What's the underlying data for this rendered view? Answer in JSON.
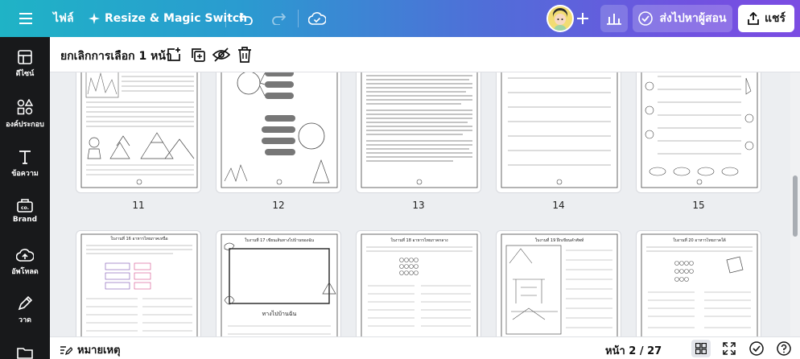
{
  "topbar": {
    "file_label": "ไฟล์",
    "resize_label": "Resize & Magic Switch",
    "send_label": "ส่งไปหาผู้สอน",
    "share_label": "แชร์"
  },
  "sidebar": {
    "items": [
      {
        "label": "ดีไซน์",
        "icon": "layout-icon"
      },
      {
        "label": "องค์ประกอบ",
        "icon": "shapes-icon"
      },
      {
        "label": "ข้อความ",
        "icon": "text-icon"
      },
      {
        "label": "Brand",
        "icon": "brand-icon"
      },
      {
        "label": "อัพโหลด",
        "icon": "upload-icon"
      },
      {
        "label": "วาด",
        "icon": "draw-icon"
      }
    ]
  },
  "selection": {
    "label": "ยกเลิกการเลือก 1 หน้า"
  },
  "pages": {
    "row1": [
      "11",
      "12",
      "13",
      "14",
      "15"
    ],
    "p16_title": "ใบงานที่ 16 อาหารไทยภาคเหนือ",
    "p17_title": "ใบงานที่ 17 เขียนเส้นทางไปบ้านของฉัน",
    "p17_caption": "ทางไปบ้านฉัน",
    "p18_title": "ใบงานที่ 18 อาหารไทยภาคกลาง",
    "p19_title": "ใบงานที่ 19 ฝึกเขียนคำศัพท์",
    "p20_title": "ใบงานที่ 20 อาหารไทยภาคใต้"
  },
  "bottombar": {
    "notes_label": "หมายเหตุ",
    "page_info": "หน้า 2 / 27"
  },
  "colors": {
    "gradient_start": "#1fb3c6",
    "gradient_end": "#7b4ce2",
    "sidebar_bg": "#18191b"
  }
}
